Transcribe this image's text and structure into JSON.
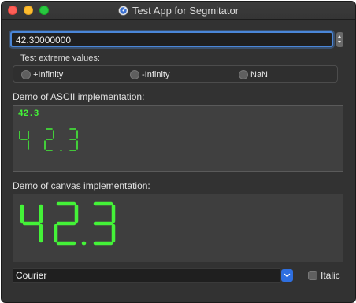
{
  "window": {
    "title": "Test App for Segmitator"
  },
  "number_field": {
    "value": "42.30000000"
  },
  "extremes": {
    "label": "Test extreme values:",
    "options": [
      {
        "label": "+Infinity",
        "selected": false
      },
      {
        "label": "-Infinity",
        "selected": false
      },
      {
        "label": "NaN",
        "selected": false
      }
    ]
  },
  "ascii_demo": {
    "label": "Demo of ASCII implementation:",
    "text": "42.3",
    "segment_value": "42.3"
  },
  "canvas_demo": {
    "label": "Demo of canvas implementation:",
    "segment_value": "42.3"
  },
  "font_combo": {
    "value": "Courier"
  },
  "italic": {
    "label": "Italic",
    "checked": false
  },
  "colors": {
    "segment_green": "#44f238",
    "accent_blue": "#2e6fe0",
    "window_bg": "#323232"
  },
  "icons": {
    "title": "app-gauge-icon",
    "stepper": "stepper-icon",
    "combo": "chevron-down-icon"
  }
}
